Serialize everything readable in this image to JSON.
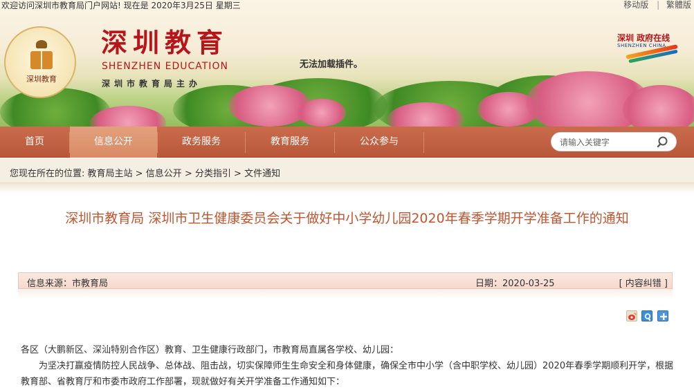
{
  "top": {
    "welcome": "欢迎访问深圳市教育局门户网站! 现在是 2020年3月25日 星期三",
    "mobile": "移动版",
    "separator": "|",
    "traditional": "繁體版"
  },
  "header": {
    "logo_text": "深圳教育",
    "title_cn": "深圳教育",
    "title_en": "SHENZHEN EDUCATION",
    "subtitle": "深圳市教育局主办",
    "plugin_message": "无法加载插件。",
    "city_logo_cn": "深圳 政府在线",
    "city_logo_en": "SHENZHEN CHINA"
  },
  "nav": {
    "items": [
      {
        "label": "首页"
      },
      {
        "label": "信息公开"
      },
      {
        "label": "政务服务"
      },
      {
        "label": "教育服务"
      },
      {
        "label": "公众参与"
      }
    ],
    "active_index": 1
  },
  "search": {
    "placeholder": "请输入关键字"
  },
  "breadcrumb": {
    "prefix": "您现在所在的位置: ",
    "items": [
      "教育局主站",
      "信息公开",
      "分类指引",
      "文件通知"
    ],
    "sep": " > "
  },
  "article": {
    "title": "深圳市教育局 深圳市卫生健康委员会关于做好中小学幼儿园2020年春季学期开学准备工作的通知",
    "source_label": "信息来源：",
    "source": "市教育局",
    "date_label": "日期：",
    "date": "2020-03-25",
    "error_link": "[ 内容纠错 ]",
    "paragraphs": [
      "各区（大鹏新区、深汕特别合作区）教育、卫生健康行政部门，市教育局直属各学校、幼儿园：",
      "为坚决打赢疫情防控人民战争、总体战、阻击战，切实保障师生生命安全和身体健康，确保全市中小学（含中职学校、幼儿园）2020年春季学期顺利开学，根据教育部、省教育厅和市委市政府工作部署，现就做好有关开学准备工作通知如下："
    ]
  },
  "colors": {
    "nav_bg": "#b9583a",
    "nav_active": "#d98b64",
    "title_red": "#b8151b",
    "article_title": "#c1552f"
  }
}
